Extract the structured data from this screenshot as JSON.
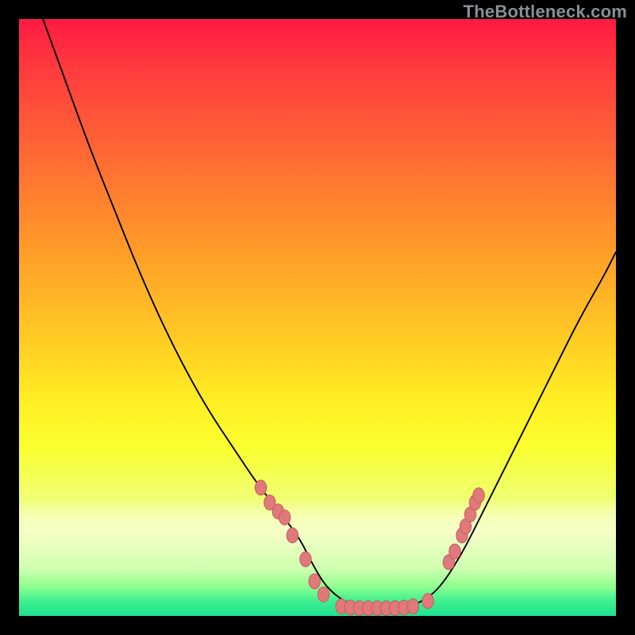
{
  "watermark": "TheBottleneck.com",
  "chart_data": {
    "type": "line",
    "title": "",
    "xlabel": "",
    "ylabel": "",
    "xlim": [
      0,
      100
    ],
    "ylim": [
      0,
      100
    ],
    "grid": false,
    "legend": false,
    "background": "red-yellow-green vertical gradient",
    "series": [
      {
        "name": "bottleneck-curve",
        "x": [
          4,
          8,
          12,
          16,
          20,
          24,
          28,
          32,
          36,
          40,
          44,
          47,
          49,
          51,
          53,
          55,
          57,
          59,
          62,
          66,
          70,
          74,
          78,
          82,
          86,
          90,
          94,
          98,
          100
        ],
        "y": [
          100,
          89,
          78,
          68,
          58,
          49,
          41,
          34,
          28,
          22,
          17,
          13,
          9,
          5.5,
          3.5,
          2.2,
          1.5,
          1.3,
          1.3,
          1.6,
          4,
          10,
          18,
          26,
          34,
          42,
          50,
          57,
          61
        ]
      }
    ],
    "markers": {
      "name": "highlighted-points",
      "type": "scatter",
      "color": "#e07a7a",
      "points": [
        {
          "x": 40.5,
          "y": 21.5
        },
        {
          "x": 42.0,
          "y": 19.0
        },
        {
          "x": 43.4,
          "y": 17.5
        },
        {
          "x": 44.5,
          "y": 16.5
        },
        {
          "x": 45.8,
          "y": 13.5
        },
        {
          "x": 48.0,
          "y": 9.5
        },
        {
          "x": 49.5,
          "y": 5.8
        },
        {
          "x": 51.0,
          "y": 3.6
        },
        {
          "x": 54.0,
          "y": 1.6
        },
        {
          "x": 55.5,
          "y": 1.4
        },
        {
          "x": 57.0,
          "y": 1.3
        },
        {
          "x": 58.5,
          "y": 1.3
        },
        {
          "x": 60.0,
          "y": 1.3
        },
        {
          "x": 61.5,
          "y": 1.3
        },
        {
          "x": 63.0,
          "y": 1.3
        },
        {
          "x": 64.5,
          "y": 1.4
        },
        {
          "x": 66.0,
          "y": 1.6
        },
        {
          "x": 68.5,
          "y": 2.5
        },
        {
          "x": 72.0,
          "y": 9.0
        },
        {
          "x": 73.0,
          "y": 10.8
        },
        {
          "x": 74.2,
          "y": 13.5
        },
        {
          "x": 74.8,
          "y": 15.0
        },
        {
          "x": 75.6,
          "y": 17.0
        },
        {
          "x": 76.4,
          "y": 19.0
        },
        {
          "x": 77.0,
          "y": 20.2
        }
      ]
    }
  }
}
